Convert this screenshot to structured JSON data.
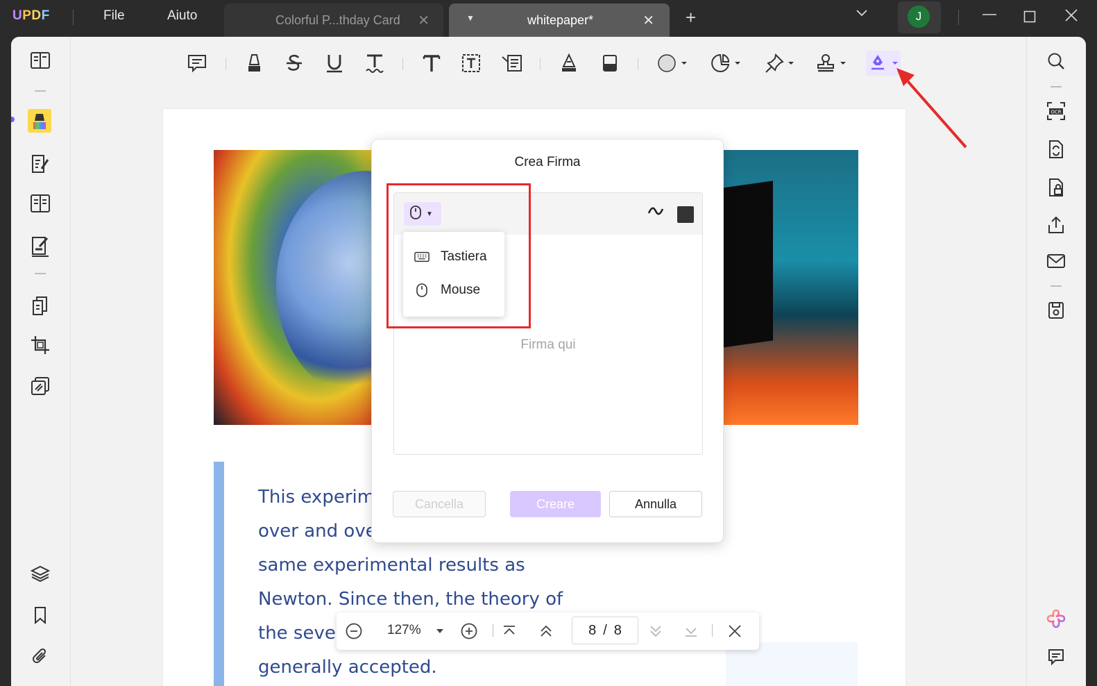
{
  "app": {
    "menu": [
      "File",
      "Aiuto"
    ],
    "tabs": [
      {
        "title": "Colorful P...thday Card",
        "close": "✕"
      },
      {
        "title": "whitepaper*",
        "close": "✕"
      }
    ],
    "user_initial": "J"
  },
  "toolbar": {
    "tools": [
      "comment",
      "highlight",
      "strikethrough",
      "underline",
      "squiggly",
      "text",
      "text-box",
      "text-callout",
      "pencil",
      "eraser",
      "shape",
      "sticker",
      "pin",
      "stamp",
      "signature"
    ]
  },
  "document": {
    "quote_lines": [
      "This experim",
      "over and over again and get the",
      "same experimental results as",
      "Newton. Since then, the theory of",
      "the seve",
      "generally accepted."
    ]
  },
  "dialog": {
    "title": "Crea Firma",
    "placeholder": "Firma qui",
    "input_options": [
      "Tastiera",
      "Mouse"
    ],
    "buttons": {
      "cancella": "Cancella",
      "creare": "Creare",
      "annulla": "Annulla"
    },
    "ink_color": "#333333"
  },
  "navigation": {
    "zoom": "127%",
    "current_page": "8",
    "separator": "/",
    "total_pages": "8"
  },
  "colors": {
    "accent": "#7b5cff",
    "annotation_red": "#e42b2b",
    "quote_text": "#2f4a8f"
  }
}
